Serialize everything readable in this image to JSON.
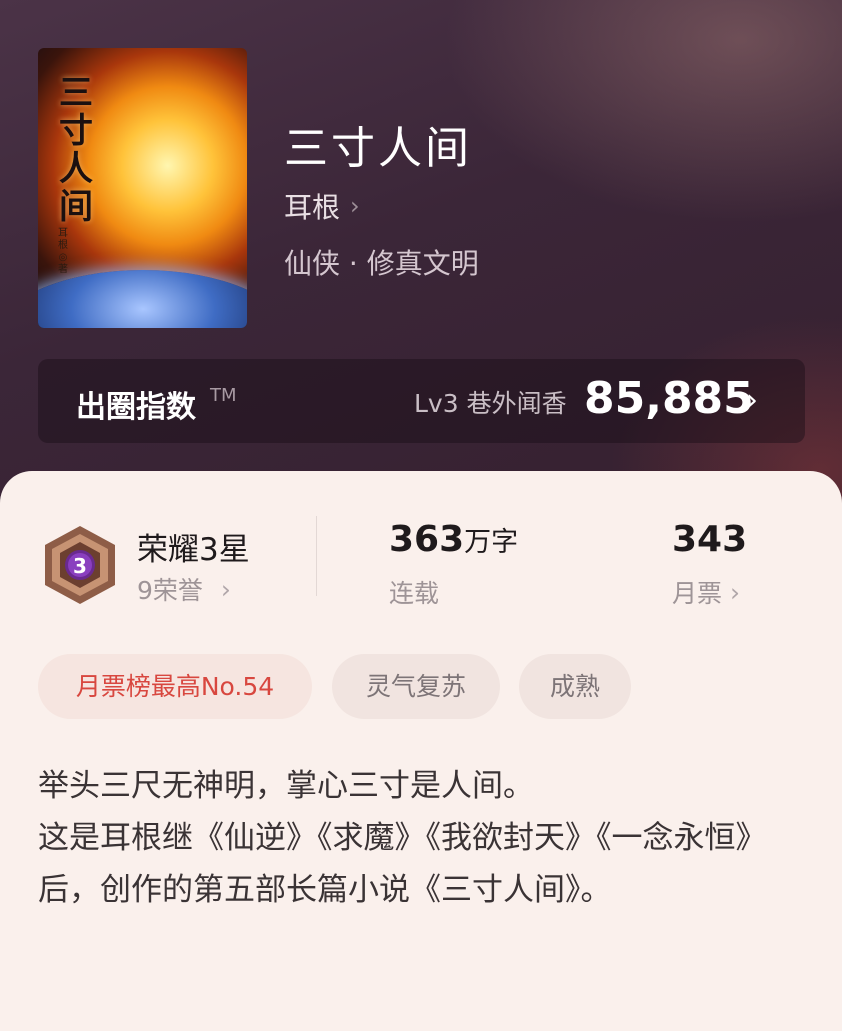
{
  "book": {
    "cover_title": "三寸人间",
    "cover_author": "耳根◎著",
    "title": "三寸人间",
    "author": "耳根",
    "genre": "仙侠 · 修真文明"
  },
  "index": {
    "label": "出圈指数",
    "tm": "TM",
    "level": "Lv3 巷外闻香",
    "score": "85,885"
  },
  "honor": {
    "badge_number": "3",
    "title": "荣耀3星",
    "subtitle": "9荣誉"
  },
  "stats": {
    "words_value": "363",
    "words_unit": "万字",
    "words_label": "连载",
    "tickets_value": "343",
    "tickets_label": "月票"
  },
  "tags": [
    "月票榜最高No.54",
    "灵气复苏",
    "成熟"
  ],
  "description": [
    "举头三尺无神明，掌心三寸是人间。",
    "这是耳根继《仙逆》《求魔》《我欲封天》《一念永恒》后，创作的第五部长篇小说《三寸人间》。"
  ],
  "colors": {
    "accent_red": "#d8473f",
    "card_bg": "#faf0ec",
    "header_bg": "#3b2638"
  }
}
